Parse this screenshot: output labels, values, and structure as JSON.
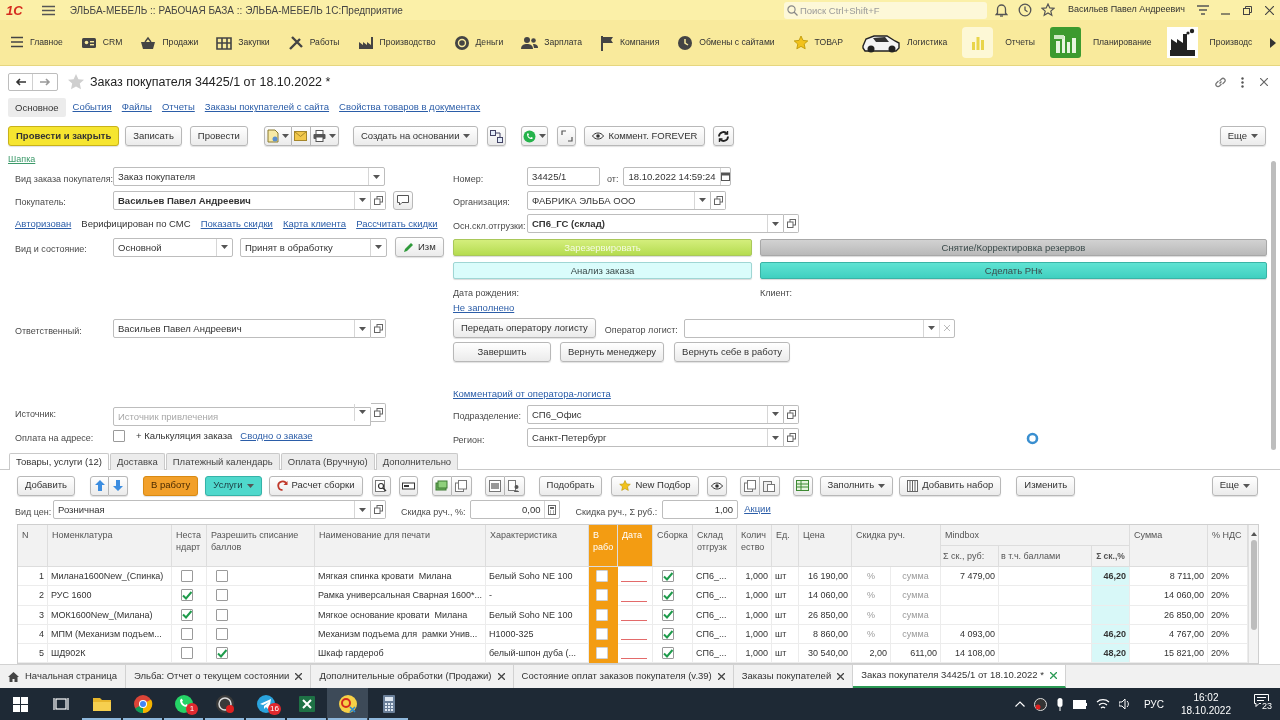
{
  "app": {
    "logo": "1С",
    "title": "ЭЛЬБА-МЕБЕЛЬ :: РАБОЧАЯ БАЗА :: ЭЛЬБА-МЕБЕЛЬ 1С:Предприятие",
    "search": {
      "placeholder": "Поиск Ctrl+Shift+F"
    },
    "user": "Васильев Павел Андреевич"
  },
  "sections": [
    {
      "label": "Главное"
    },
    {
      "label": "CRM"
    },
    {
      "label": "Продажи"
    },
    {
      "label": "Закупки"
    },
    {
      "label": "Работы"
    },
    {
      "label": "Производство"
    },
    {
      "label": "Деньги"
    },
    {
      "label": "Зарплата"
    },
    {
      "label": "Компания"
    },
    {
      "label": "Обмены с сайтами"
    },
    {
      "label": "ТОВАР"
    },
    {
      "label": "Логистика"
    },
    {
      "label": "Отчеты"
    },
    {
      "label": "Планирование"
    },
    {
      "label": "Производс"
    }
  ],
  "document": {
    "title": "Заказ покупателя 34425/1 от 18.10.2022 *",
    "nav": [
      {
        "label": "Основное",
        "selected": true
      },
      {
        "label": "События",
        "selected": false
      },
      {
        "label": "Файлы",
        "selected": false
      },
      {
        "label": "Отчеты",
        "selected": false
      },
      {
        "label": "Заказы покупателей с сайта",
        "selected": false
      },
      {
        "label": "Свойства товаров в документах",
        "selected": false
      }
    ]
  },
  "toolbar": {
    "post_close": "Провести и закрыть",
    "save": "Записать",
    "post": "Провести",
    "create_based": "Создать на основании",
    "comment": "Коммент. FOREVER",
    "more": "Еще"
  },
  "group_link": "Шапка",
  "form": {
    "order_kind": {
      "label": "Вид заказа покупателя:",
      "value": "Заказ покупателя"
    },
    "customer": {
      "label": "Покупатель:",
      "value": "Васильев Павел Андреевич"
    },
    "customer_links": [
      {
        "kind": "link",
        "text": "Авторизован"
      },
      {
        "kind": "text",
        "text": "Верифицирован по СМС"
      },
      {
        "kind": "link",
        "text": "Показать скидки"
      },
      {
        "kind": "link",
        "text": "Карта клиента"
      },
      {
        "kind": "link",
        "text": "Рассчитать скидки"
      }
    ],
    "view_state": {
      "label": "Вид и состояние:",
      "view": "Основной",
      "state": "Принят в обработку",
      "edit": "Изм"
    },
    "responsible": {
      "label": "Ответственный:",
      "value": "Васильев Павел Андреевич"
    },
    "source": {
      "label": "Источник:",
      "placeholder": "Источник привлечения"
    },
    "pay_on_address": {
      "label": "Оплата на адресе:",
      "checked": false
    },
    "calculation": "+ Калькуляция заказа",
    "summary_link": "Сводно о заказе",
    "number": {
      "label": "Номер:",
      "value": "34425/1"
    },
    "date": {
      "label": "от:",
      "value": "18.10.2022 14:59:24"
    },
    "organization": {
      "label": "Организация:",
      "value": "ФАБРИКА ЭЛЬБА ООО"
    },
    "warehouse": {
      "label": "Осн.скл.отгрузки:",
      "value": "СП6_ГС (склад)"
    },
    "actions": [
      {
        "label": "Зарезервировать",
        "disabled": true
      },
      {
        "label": "Снятие/Корректировка резервов",
        "disabled": false
      },
      {
        "label": "Анализ заказа",
        "disabled": false
      },
      {
        "label": "Сделать РНк",
        "disabled": false
      }
    ],
    "birth_date_label": "Дата рождения:",
    "client_label": "Клиент:",
    "birth_date_link": "Не заполнено",
    "logist": {
      "button": "Передать оператору логисту",
      "label": "Оператор логист:"
    },
    "logist_buttons": [
      "Завершить",
      "Вернуть менеджеру",
      "Вернуть себе в работу"
    ],
    "logist_comment_link": "Комментарий от оператора-логиста",
    "department": {
      "label": "Подразделение:",
      "value": "СП6_Офис"
    },
    "region": {
      "label": "Регион:",
      "value": "Санкт-Петербург"
    }
  },
  "table": {
    "tabs": [
      {
        "label": "Товары, услуги (12)",
        "selected": true
      },
      {
        "label": "Доставка",
        "selected": false
      },
      {
        "label": "Платежный календарь",
        "selected": false
      },
      {
        "label": "Оплата (Вручную)",
        "selected": false
      },
      {
        "label": "Дополнительно",
        "selected": false
      }
    ],
    "toolbar": {
      "add": "Добавить",
      "to_work": "В работу",
      "services": "Услуги",
      "calc": "Расчет сборки",
      "pick": "Подобрать",
      "new_pick": "New Подбор",
      "fill": "Заполнить",
      "add_set": "Добавить набор",
      "change": "Изменить",
      "more": "Еще"
    },
    "price_kind": {
      "label": "Вид цен:",
      "value": "Розничная"
    },
    "discount_pct": {
      "label": "Скидка руч., %:",
      "value": "0,00"
    },
    "discount_sum": {
      "label": "Скидка руч., Σ руб.:",
      "value": "1,00"
    },
    "promo_link": "Акции",
    "columns": [
      "N",
      "Номенклатура",
      "Нестандарт",
      "Разрешить списание баллов",
      "Наименование для печати",
      "Характеристика",
      "В рабо",
      "Дата",
      "Сборка",
      "Склад отгрузк",
      "Количество",
      "Ед.",
      "Цена",
      "Скидка руч.",
      "Mindbox",
      "Сумма",
      "% НДС"
    ],
    "mindbox_columns": [
      "Σ ск., руб:",
      "в т.ч. баллами",
      "Σ ск.,%"
    ],
    "rows": [
      {
        "n": "1",
        "item": "Милана1600New_(Спинка)",
        "nonstandard": false,
        "allow_points": false,
        "print_name": "Мягкая спинка кровати  Милана",
        "characteristic": "Белый Soho NE 100",
        "in_work": false,
        "assembly": true,
        "warehouse": "СП6_...",
        "qty": "1,000",
        "unit": "шт",
        "price": "16 190,00",
        "discount_pct": {
          "placeholder": "%"
        },
        "discount_sum": {
          "placeholder": "сумма"
        },
        "mindbox_sum": "7 479,00",
        "mindbox_pct": "46,20",
        "sum": "8 711,00",
        "vat": "20%"
      },
      {
        "n": "2",
        "item": "РУС 1600",
        "nonstandard": true,
        "allow_points": false,
        "print_name": "Рамка универсальная Сварная 1600*...",
        "characteristic": "-",
        "in_work": false,
        "assembly": true,
        "warehouse": "СП6_...",
        "qty": "1,000",
        "unit": "шт",
        "price": "14 060,00",
        "discount_pct": {
          "placeholder": "%"
        },
        "discount_sum": {
          "placeholder": "сумма"
        },
        "sum": "14 060,00",
        "vat": "20%"
      },
      {
        "n": "3",
        "item": "МОК1600New_(Милана)",
        "nonstandard": true,
        "allow_points": false,
        "print_name": "Мягкое основание кровати  Милана",
        "characteristic": "Белый Soho NE 100",
        "in_work": false,
        "assembly": true,
        "warehouse": "СП6_...",
        "qty": "1,000",
        "unit": "шт",
        "price": "26 850,00",
        "discount_pct": {
          "placeholder": "%"
        },
        "discount_sum": {
          "placeholder": "сумма"
        },
        "sum": "26 850,00",
        "vat": "20%"
      },
      {
        "n": "4",
        "item": "МПМ (Механизм подъем...",
        "nonstandard": false,
        "allow_points": false,
        "print_name": "Механизм подъема для  рамки Унив...",
        "characteristic": "Н1000-325",
        "in_work": false,
        "assembly": true,
        "warehouse": "СП6_...",
        "qty": "1,000",
        "unit": "шт",
        "price": "8 860,00",
        "discount_pct": {
          "placeholder": "%"
        },
        "discount_sum": {
          "placeholder": "сумма"
        },
        "mindbox_sum": "4 093,00",
        "mindbox_pct": "46,20",
        "sum": "4 767,00",
        "vat": "20%"
      },
      {
        "n": "5",
        "item": "ШД902К",
        "nonstandard": false,
        "allow_points": true,
        "print_name": "Шкаф гардероб",
        "characteristic": "белый-шпон дуба (...",
        "in_work": false,
        "assembly": true,
        "warehouse": "СП6_...",
        "qty": "1,000",
        "unit": "шт",
        "price": "30 540,00",
        "discount_pct": {
          "value": "2,00"
        },
        "discount_sum": {
          "value": "611,00"
        },
        "mindbox_sum": "14 108,00",
        "mindbox_pct": "48,20",
        "sum": "15 821,00",
        "vat": "20%"
      }
    ]
  },
  "open_windows": [
    {
      "label": "Начальная страница",
      "closable": false,
      "selected": false
    },
    {
      "label": "Эльба: Отчет о текущем состоянии",
      "closable": true,
      "selected": false
    },
    {
      "label": "Дополнительные обработки (Продажи)",
      "closable": true,
      "selected": false
    },
    {
      "label": "Состояние оплат заказов покупателя (v.39)",
      "closable": true,
      "selected": false
    },
    {
      "label": "Заказы покупателей",
      "closable": true,
      "selected": false
    },
    {
      "label": "Заказ покупателя 34425/1 от 18.10.2022 *",
      "closable": true,
      "selected": true
    }
  ],
  "taskbar": {
    "apps": [
      {
        "running": true,
        "selected": false
      },
      {
        "running": true,
        "selected": false
      },
      {
        "running": true,
        "selected": false,
        "badge": "1"
      },
      {
        "running": true,
        "selected": false
      },
      {
        "running": true,
        "selected": false,
        "badge": "16"
      },
      {
        "running": true,
        "selected": false
      },
      {
        "running": true,
        "selected": true
      },
      {
        "running": true,
        "selected": false
      }
    ],
    "lang": "РУС",
    "time": "16:02",
    "date": "18.10.2022",
    "notifications": "23"
  }
}
